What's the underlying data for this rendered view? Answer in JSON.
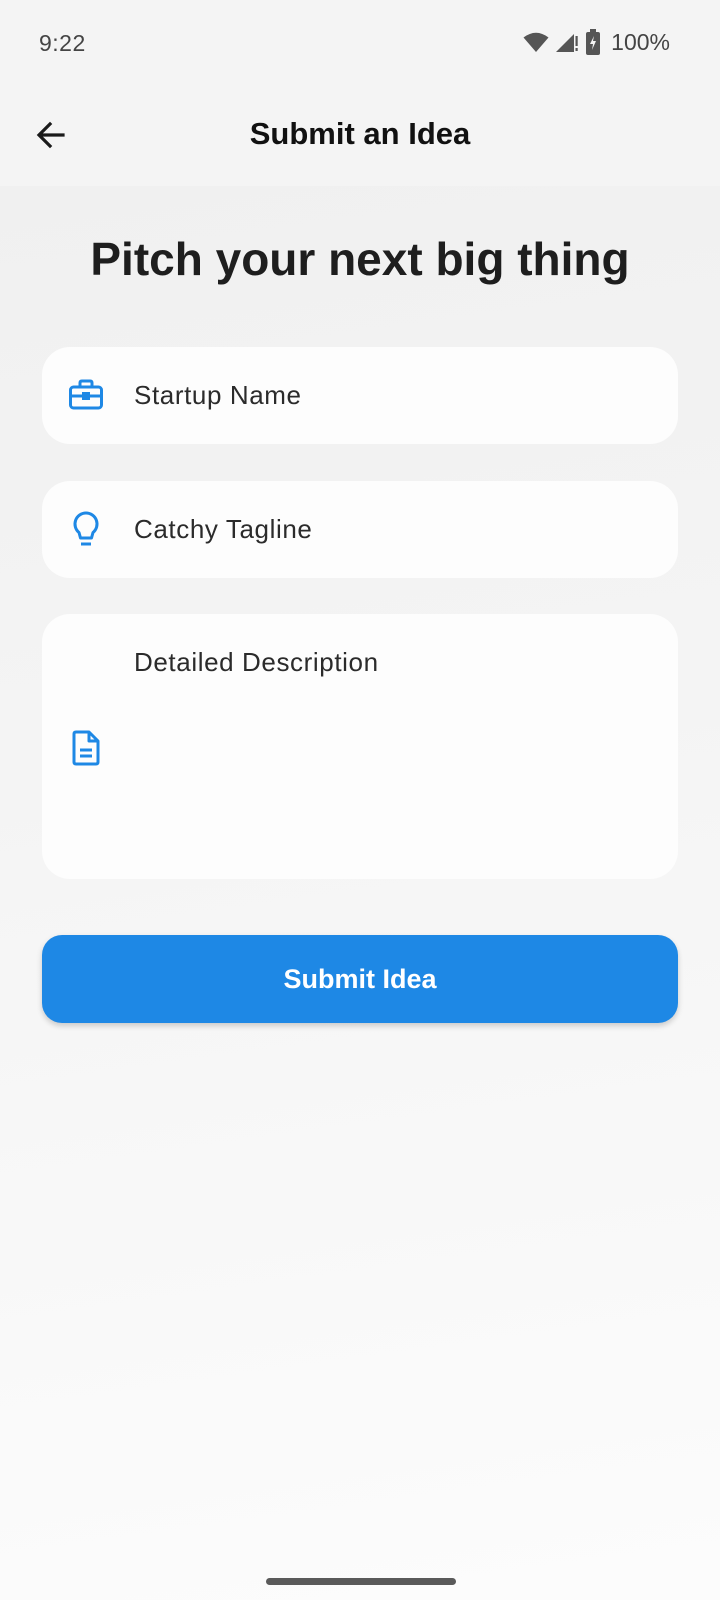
{
  "status_bar": {
    "time": "9:22",
    "battery": "100%",
    "icons": [
      "wifi-icon",
      "signal-icon",
      "battery-icon"
    ]
  },
  "app_bar": {
    "title": "Submit an Idea",
    "back_icon": "arrow-back-icon"
  },
  "headline": "Pitch your next big thing",
  "form": {
    "fields": [
      {
        "label": "Startup Name",
        "icon": "briefcase-icon"
      },
      {
        "label": "Catchy Tagline",
        "icon": "lightbulb-icon"
      },
      {
        "label": "Detailed Description",
        "icon": "document-icon"
      }
    ],
    "submit_label": "Submit Idea"
  },
  "colors": {
    "accent": "#1e88e5",
    "field_background": "#fdfdfd",
    "page_background": "#f2f2f2"
  }
}
